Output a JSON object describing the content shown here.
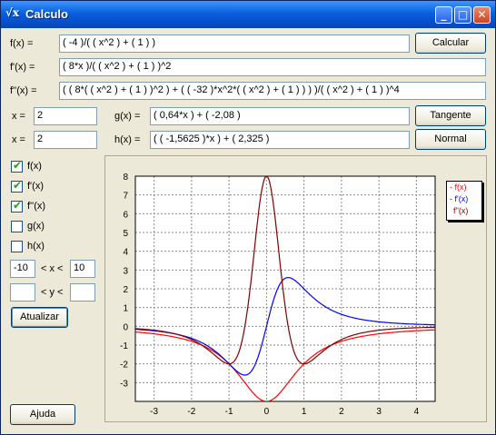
{
  "window": {
    "title": "Calculo",
    "icon": "sqrt-x-icon"
  },
  "titlebar_buttons": [
    {
      "name": "minimize",
      "glyph": "_"
    },
    {
      "name": "maximize",
      "glyph": "□"
    },
    {
      "name": "close",
      "glyph": "✕"
    }
  ],
  "functions": {
    "f_label": "f(x) =",
    "f_value": "( -4 )/( ( x^2 ) + ( 1 ) )",
    "fp_label": "f'(x) =",
    "fp_value": "( 8*x )/( ( x^2 ) + ( 1 ) )^2",
    "fpp_label": "f''(x) =",
    "fpp_value": "( ( 8*( ( x^2 ) + ( 1 ) )^2 ) + ( ( -32 )*x^2*( ( x^2 ) + ( 1 ) ) ) )/( ( x^2 ) + ( 1 ) )^4"
  },
  "tangent": {
    "x_label": "x =",
    "x_value": "2",
    "g_label": "g(x) =",
    "g_value": "( 0,64*x ) + ( -2,08 )"
  },
  "normal": {
    "x_label": "x =",
    "x_value": "2",
    "h_label": "h(x) =",
    "h_value": "( ( -1,5625 )*x ) + ( 2,325 )"
  },
  "buttons": {
    "calcular": "Calcular",
    "tangente": "Tangente",
    "normal": "Normal",
    "atualizar": "Atualizar",
    "ajuda": "Ajuda"
  },
  "checkboxes": [
    {
      "label": "f(x)",
      "checked": true
    },
    {
      "label": "f'(x)",
      "checked": true
    },
    {
      "label": "f''(x)",
      "checked": true
    },
    {
      "label": "g(x)",
      "checked": false
    },
    {
      "label": "h(x)",
      "checked": false
    }
  ],
  "range": {
    "x_min": "-10",
    "x_label": "< x <",
    "x_max": "10",
    "y_min": "",
    "y_label": "< y <",
    "y_max": ""
  },
  "chart_data": {
    "type": "line",
    "xlim": [
      -3.5,
      4.5
    ],
    "ylim": [
      -4,
      8
    ],
    "x_ticks": [
      "-3",
      "-2",
      "-1",
      "0",
      "1",
      "2",
      "3",
      "4"
    ],
    "y_ticks": [
      "8",
      "7",
      "6",
      "5",
      "4",
      "3",
      "2",
      "1",
      "0",
      "-1",
      "-2",
      "-3"
    ],
    "grid": true,
    "legend_placement": "right",
    "series": [
      {
        "name": "- f(x)",
        "expression": "f",
        "color": "#ff0000"
      },
      {
        "name": "- f'(x)",
        "expression": "fp",
        "color": "#0000ff"
      },
      {
        "name": "f''(x)",
        "expression": "fpp",
        "color": "#800000"
      }
    ]
  }
}
